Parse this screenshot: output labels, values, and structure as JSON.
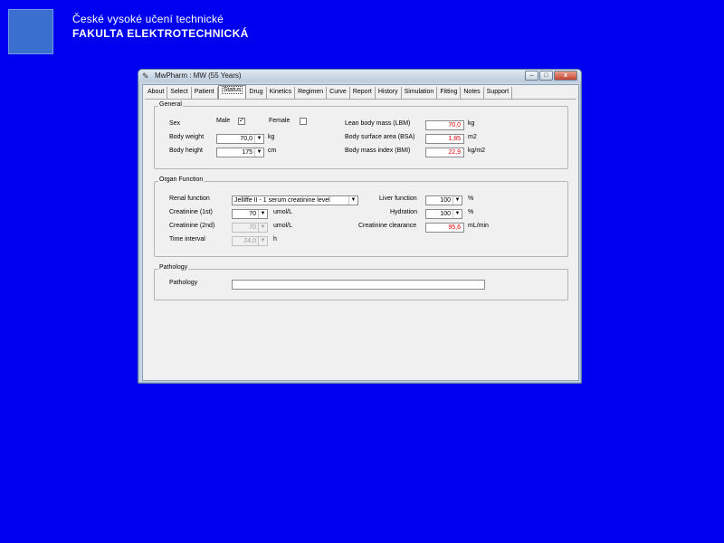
{
  "header": {
    "line1": "České vysoké učení technické",
    "line2": "FAKULTA ELEKTROTECHNICKÁ"
  },
  "window": {
    "title": "MwPharm : MW (55 Years)",
    "min_glyph": "–",
    "max_glyph": "□",
    "close_glyph": "x"
  },
  "tabs": [
    "About",
    "Select",
    "Patient",
    "Status",
    "Drug",
    "Kinetics",
    "Regimen",
    "Curve",
    "Report",
    "History",
    "Simulation",
    "Fitting",
    "Notes",
    "Support"
  ],
  "active_tab": "Status",
  "general": {
    "title": "General",
    "sex_label": "Sex",
    "male_label": "Male",
    "male_checked": "✓",
    "female_label": "Female",
    "body_weight_label": "Body weight",
    "body_weight_value": "70,0",
    "body_weight_unit": "kg",
    "body_height_label": "Body height",
    "body_height_value": "175",
    "body_height_unit": "cm",
    "lbm_label": "Lean body mass (LBM)",
    "lbm_value": "70,0",
    "lbm_unit": "kg",
    "bsa_label": "Body surface area (BSA)",
    "bsa_value": "1,85",
    "bsa_unit": "m2",
    "bmi_label": "Body mass index (BMI)",
    "bmi_value": "22,9",
    "bmi_unit": "kg/m2"
  },
  "organ": {
    "title": "Organ Function",
    "renal_label": "Renal function",
    "renal_value": "Jelliffe II - 1 serum creatinine level",
    "creat1_label": "Creatinine (1st)",
    "creat1_value": "70",
    "creat1_unit": "umol/L",
    "creat2_label": "Creatinine (2nd)",
    "creat2_value": "70",
    "creat2_unit": "umol/L",
    "interval_label": "Time interval",
    "interval_value": "24,0",
    "interval_unit": "h",
    "liver_label": "Liver function",
    "liver_value": "100",
    "liver_unit": "%",
    "hydration_label": "Hydration",
    "hydration_value": "100",
    "hydration_unit": "%",
    "clearance_label": "Creatinine clearance",
    "clearance_value": "95,6",
    "clearance_unit": "mL/min"
  },
  "pathology": {
    "title": "Pathology",
    "label": "Pathology",
    "value": ""
  },
  "colors": {
    "desktop": "#0000f0",
    "computed_value": "#e00000"
  }
}
